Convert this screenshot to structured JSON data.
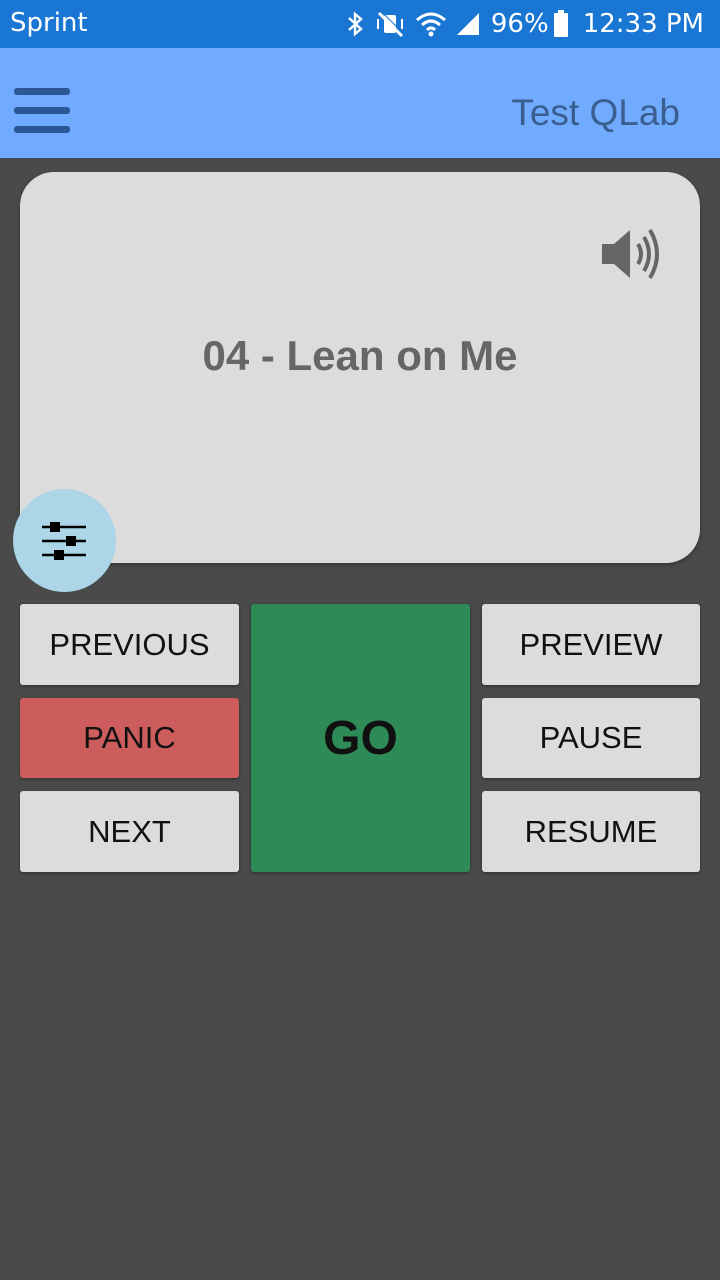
{
  "status_bar": {
    "carrier": "Sprint",
    "battery": "96%",
    "time": "12:33 PM",
    "icons": [
      "bluetooth-icon",
      "vibrate-mute-icon",
      "wifi-icon",
      "signal-icon",
      "battery-icon"
    ]
  },
  "app_bar": {
    "title": "Test QLab",
    "menu_icon": "hamburger-menu-icon"
  },
  "cue": {
    "title": "04 - Lean on Me",
    "type_icon": "volume-icon",
    "fab_icon": "sliders-icon"
  },
  "controls": {
    "previous": "PREVIOUS",
    "panic": "PANIC",
    "next": "NEXT",
    "go": "GO",
    "preview": "PREVIEW",
    "pause": "PAUSE",
    "resume": "RESUME"
  },
  "colors": {
    "status_bar": "#1976d2",
    "app_bar": "#70abff",
    "background": "#4a4a4a",
    "card": "#dcdcdc",
    "panic": "#cd5c5c",
    "go": "#2e8b57",
    "fab": "#acd5e8"
  }
}
